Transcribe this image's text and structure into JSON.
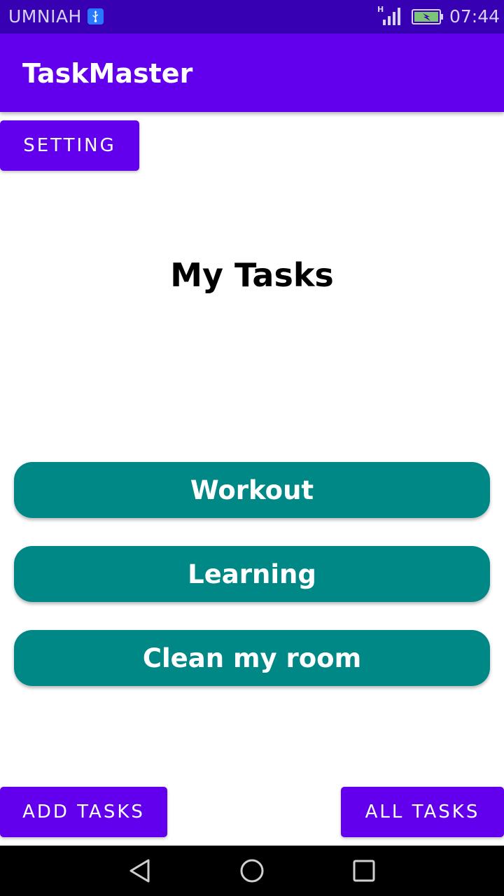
{
  "status_bar": {
    "carrier": "UMNIAH",
    "time": "07:44",
    "network_type": "H",
    "icons": [
      "usb-icon",
      "signal-icon",
      "battery-icon"
    ]
  },
  "app_bar": {
    "title": "TaskMaster"
  },
  "buttons": {
    "setting": "SETTING",
    "add_tasks": "ADD TASKS",
    "all_tasks": "ALL TASKS"
  },
  "main": {
    "title": "My Tasks",
    "tasks": [
      "Workout",
      "Learning",
      "Clean my room"
    ]
  },
  "nav_bar": {
    "icons": [
      "back-icon",
      "home-icon",
      "recent-apps-icon"
    ]
  },
  "colors": {
    "status_bar": "#3700B3",
    "primary": "#6200EE",
    "task_button": "#008886"
  }
}
